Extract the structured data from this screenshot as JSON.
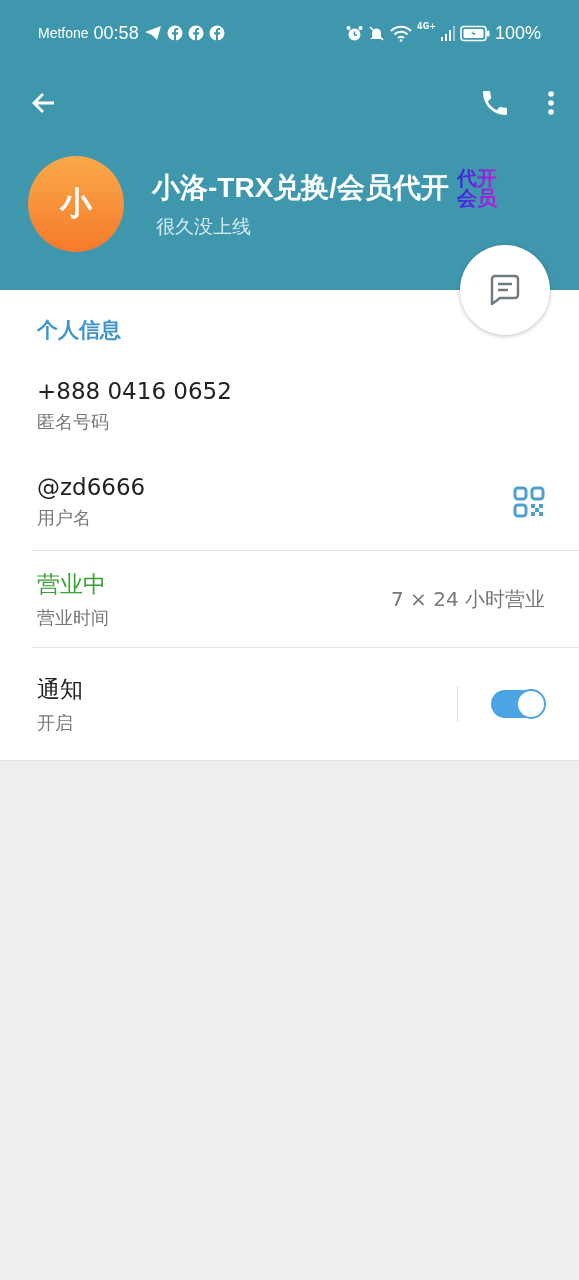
{
  "status_bar": {
    "carrier": "Metfone",
    "time": "00:58",
    "network": "4G+",
    "battery": "100%"
  },
  "profile": {
    "avatar_letter": "小",
    "name": "小洛-TRX兑换/会员代开",
    "badge": "代开会员",
    "status": "很久没上线"
  },
  "info": {
    "heading": "个人信息",
    "rows": [
      {
        "kind": "field",
        "value": "+888 0416 0652",
        "label": "匿名号码"
      },
      {
        "kind": "qr",
        "value": "@zd6666",
        "label": "用户名"
      },
      {
        "kind": "hours",
        "value": "营业中",
        "label": "营业时间",
        "detail": "7 × 24 小时营业"
      },
      {
        "kind": "toggle",
        "value": "通知",
        "label": "开启",
        "on": true
      }
    ]
  }
}
